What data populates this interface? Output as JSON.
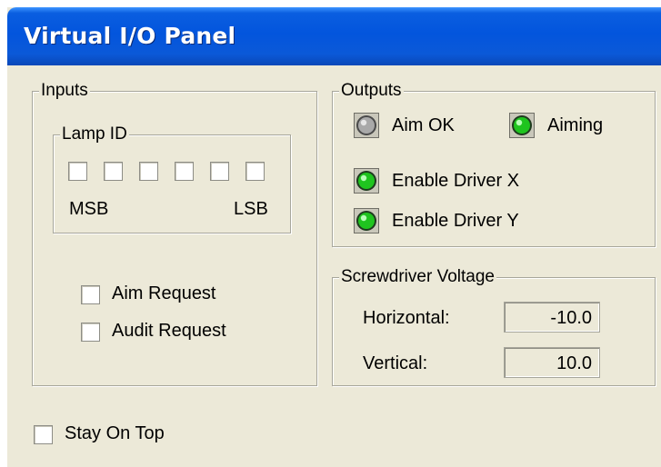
{
  "window": {
    "title": "Virtual I/O Panel"
  },
  "inputs": {
    "legend": "Inputs",
    "lamp_id": {
      "legend": "Lamp ID",
      "bits": [
        false,
        false,
        false,
        false,
        false,
        false
      ],
      "msb_label": "MSB",
      "lsb_label": "LSB"
    },
    "aim_request": {
      "label": "Aim Request",
      "checked": false
    },
    "audit_request": {
      "label": "Audit Request",
      "checked": false
    }
  },
  "outputs": {
    "legend": "Outputs",
    "aim_ok": {
      "label": "Aim OK",
      "state": "off"
    },
    "aiming": {
      "label": "Aiming",
      "state": "on"
    },
    "enable_driver_x": {
      "label": "Enable Driver X",
      "state": "on"
    },
    "enable_driver_y": {
      "label": "Enable Driver Y",
      "state": "on"
    }
  },
  "screwdriver_voltage": {
    "legend": "Screwdriver Voltage",
    "horizontal": {
      "label": "Horizontal:",
      "value": "-10.0"
    },
    "vertical": {
      "label": "Vertical:",
      "value": "10.0"
    }
  },
  "stay_on_top": {
    "label": "Stay On Top",
    "checked": false
  },
  "colors": {
    "title_bar": "#0355dd",
    "window_bg": "#ece9d8",
    "led_on": "#1fc41f",
    "led_off": "#a9a9a9"
  }
}
